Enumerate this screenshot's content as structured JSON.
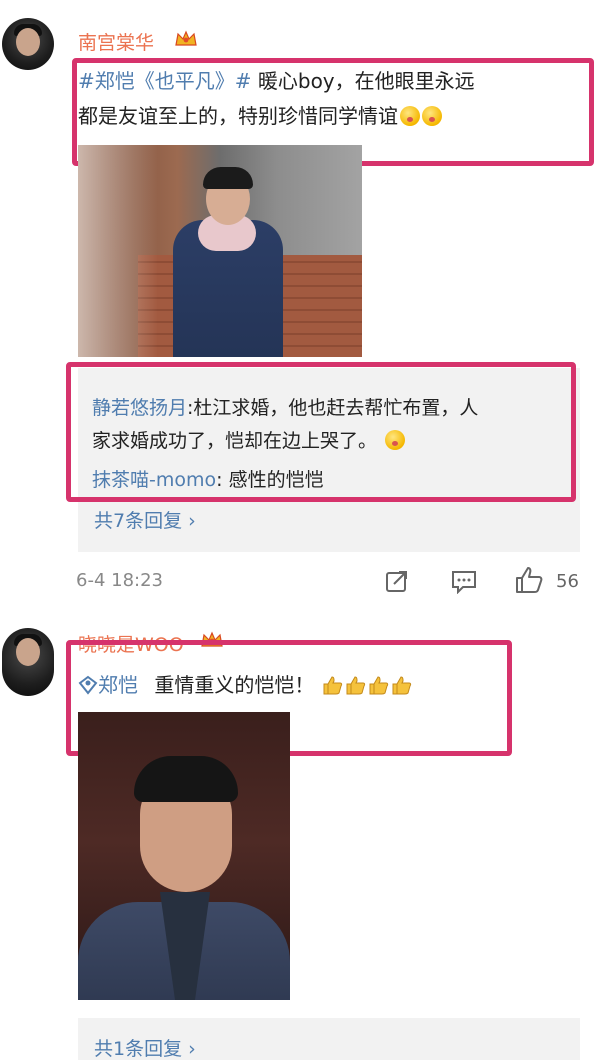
{
  "post1": {
    "username": "南宫棠华",
    "topic": "#郑恺《也平凡》#",
    "text_line1": "暖心boy，在他眼里永远",
    "text_line2": "都是友谊至上的，特别珍惜同学情谊",
    "replies": [
      {
        "name": "静若悠扬月",
        "text_line1": ":杜江求婚，他也赶去帮忙布置，人",
        "text_line2": "家求婚成功了，恺却在边上哭了。"
      },
      {
        "name": "抹茶喵-momo",
        "text_line1": ": 感性的恺恺"
      }
    ],
    "more_replies": "共7条回复 ›",
    "timestamp": "6-4 18:23",
    "like_count": "56"
  },
  "post2": {
    "username": "晓晓是WOO",
    "mention": "郑恺",
    "text": "重情重义的恺恺！",
    "more_replies": "共1条回复 ›"
  },
  "colors": {
    "highlight": "#d6336c",
    "link": "#507daf",
    "username": "#eb7350",
    "reply_bg": "#f2f2f2"
  },
  "icons": [
    "crown-icon",
    "emoji-icon",
    "repost-icon",
    "comment-icon",
    "like-icon",
    "thumbs-up-icon",
    "at-mention-icon"
  ]
}
